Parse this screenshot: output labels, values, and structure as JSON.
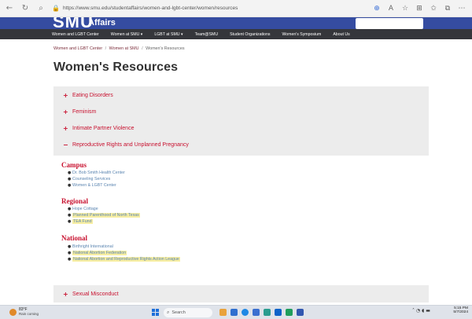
{
  "browser": {
    "url": "https://www.smu.edu/studentaffairs/women-and-lgbt-center/women/resources",
    "toolbar_icons": [
      "back-icon",
      "refresh-icon",
      "search-icon"
    ],
    "right_icons": [
      "extensions-icon",
      "read-aloud-icon",
      "favorite-icon",
      "split-screen-icon",
      "favorites-icon",
      "collections-icon",
      "more-icon"
    ]
  },
  "site": {
    "logo_primary": "SMU",
    "logo_secondary": "Affairs",
    "nav": [
      "Women and LGBT Center",
      "Women at SMU ▾",
      "LGBT at SMU ▾",
      "Team@SMU",
      "Student Organizations",
      "Women's Symposium",
      "About Us"
    ]
  },
  "breadcrumb": {
    "items": [
      "Women and LGBT Center",
      "Women at SMU",
      "Women's Resources"
    ]
  },
  "page_title": "Women's Resources",
  "accordion": {
    "items": [
      {
        "sign": "+",
        "label": "Eating Disorders"
      },
      {
        "sign": "+",
        "label": "Feminism"
      },
      {
        "sign": "+",
        "label": "Intimate Partner Violence"
      },
      {
        "sign": "−",
        "label": "Reproductive Rights and Unplanned Pregnancy"
      }
    ],
    "bottom": {
      "sign": "+",
      "label": "Sexual Misconduct"
    }
  },
  "sections": {
    "campus": {
      "heading": "Campus",
      "links": [
        "Dr. Bob Smith Health Center",
        "Counseling Services",
        "Women & LGBT Center"
      ]
    },
    "regional": {
      "heading": "Regional",
      "links": [
        "Hope Cottage",
        "Planned Parenthood of North Texas",
        "TEA Fund"
      ]
    },
    "national": {
      "heading": "National",
      "links": [
        "Birthright International",
        "National Abortion Federation",
        "National Abortion and Reproductive Rights Action League"
      ]
    }
  },
  "taskbar": {
    "weather_temp": "83°F",
    "weather_cond": "Rain coming",
    "search_placeholder": "Search",
    "time": "5:15 PM",
    "date": "5/7/2024"
  },
  "colors": {
    "accent_red": "#c8102e",
    "header_blue": "#354ca1",
    "nav_dark": "#35363b",
    "highlight": "#f7eea2"
  }
}
